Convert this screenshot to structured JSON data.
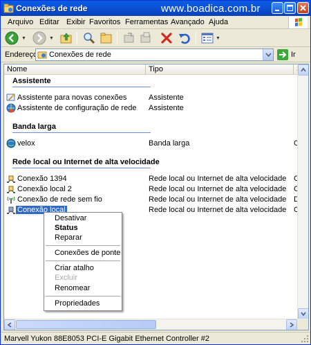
{
  "window": {
    "title": "Conexões de rede",
    "watermark": "www.boadica.com.br",
    "colors": {
      "titlebar": "#0a4fd0",
      "selection": "#316ac5",
      "group_line": "#6d8fd9"
    }
  },
  "menu": {
    "items": [
      "Arquivo",
      "Editar",
      "Exibir",
      "Favoritos",
      "Ferramentas",
      "Avançado",
      "Ajuda"
    ]
  },
  "toolbar": {
    "icons": [
      "back-icon",
      "forward-icon",
      "up-folder-icon",
      "search-icon",
      "folders-icon",
      "move-to-icon",
      "copy-to-icon",
      "delete-icon",
      "undo-icon",
      "views-icon"
    ]
  },
  "address": {
    "label": "Endereço",
    "value": "Conexões de rede",
    "go_label": "Ir"
  },
  "columns": [
    "Nome",
    "Tipo",
    "Statu"
  ],
  "groups": [
    {
      "label": "Assistente",
      "rows": [
        {
          "name": "Assistente para novas conexões",
          "type": "Assistente",
          "status": "",
          "icon": "wizard-icon"
        },
        {
          "name": "Assistente de configuração de rede",
          "type": "Assistente",
          "status": "",
          "icon": "network-setup-icon"
        }
      ]
    },
    {
      "label": "Banda larga",
      "rows": [
        {
          "name": "velox",
          "type": "Banda larga",
          "status": "Cone",
          "icon": "broadband-icon"
        }
      ]
    },
    {
      "label": "Rede local ou Internet de alta velocidade",
      "rows": [
        {
          "name": "Conexão 1394",
          "type": "Rede local ou Internet de alta velocidade",
          "status": "Cone",
          "icon": "lan-icon"
        },
        {
          "name": "Conexão local 2",
          "type": "Rede local ou Internet de alta velocidade",
          "status": "Cone",
          "icon": "lan-icon"
        },
        {
          "name": "Conexão de rede sem fio",
          "type": "Rede local ou Internet de alta velocidade",
          "status": "Desc",
          "icon": "wireless-icon"
        },
        {
          "name": "Conexão local",
          "type": "Rede local ou Internet de alta velocidade",
          "status": "Cone",
          "icon": "lan-icon",
          "selected": true
        }
      ]
    }
  ],
  "context_menu": {
    "items": [
      {
        "label": "Desativar"
      },
      {
        "label": "Status",
        "bold": true
      },
      {
        "label": "Reparar"
      },
      {
        "separator": true
      },
      {
        "label": "Conexões de ponte"
      },
      {
        "separator": true
      },
      {
        "label": "Criar atalho"
      },
      {
        "label": "Excluir",
        "disabled": true
      },
      {
        "label": "Renomear"
      },
      {
        "separator": true
      },
      {
        "label": "Propriedades"
      }
    ]
  },
  "statusbar": {
    "text": "Marvell Yukon 88E8053 PCI-E Gigabit Ethernet Controller #2"
  }
}
